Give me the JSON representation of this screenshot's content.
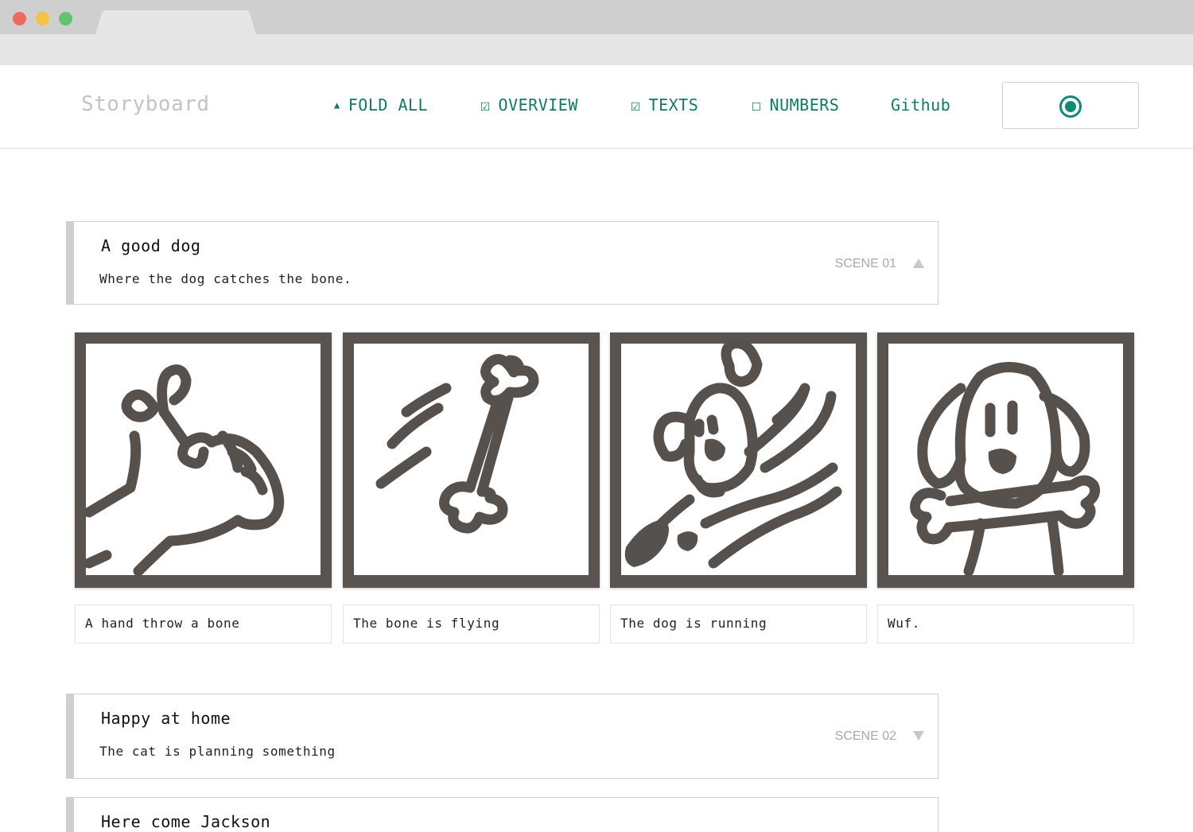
{
  "app": {
    "logo": "Storyboard"
  },
  "nav": {
    "fold_all": {
      "glyph": "▲",
      "label": "FOLD ALL"
    },
    "overview": {
      "glyph": "☑",
      "label": "OVERVIEW"
    },
    "texts": {
      "glyph": "☑",
      "label": "TEXTS"
    },
    "numbers": {
      "glyph": "☐",
      "label": "NUMBERS"
    },
    "github": {
      "label": "Github"
    },
    "record_icon": "record-icon"
  },
  "colors": {
    "accent": "#0f7a66",
    "ink": "#57514d",
    "muted": "#a8a8a8"
  },
  "scenes": [
    {
      "title": "A good dog",
      "description": "Where the dog catches the bone.",
      "number": "SCENE 01",
      "state": "expanded",
      "panels": [
        {
          "caption": "A hand throw a bone",
          "image": "hand-throwing-bone"
        },
        {
          "caption": "The bone is flying",
          "image": "flying-bone"
        },
        {
          "caption": "The dog is running",
          "image": "running-dog"
        },
        {
          "caption": "Wuf.",
          "image": "dog-with-bone"
        }
      ]
    },
    {
      "title": "Happy at home",
      "description": "The cat is planning something",
      "number": "SCENE 02",
      "state": "collapsed"
    },
    {
      "title": "Here come Jackson"
    }
  ]
}
